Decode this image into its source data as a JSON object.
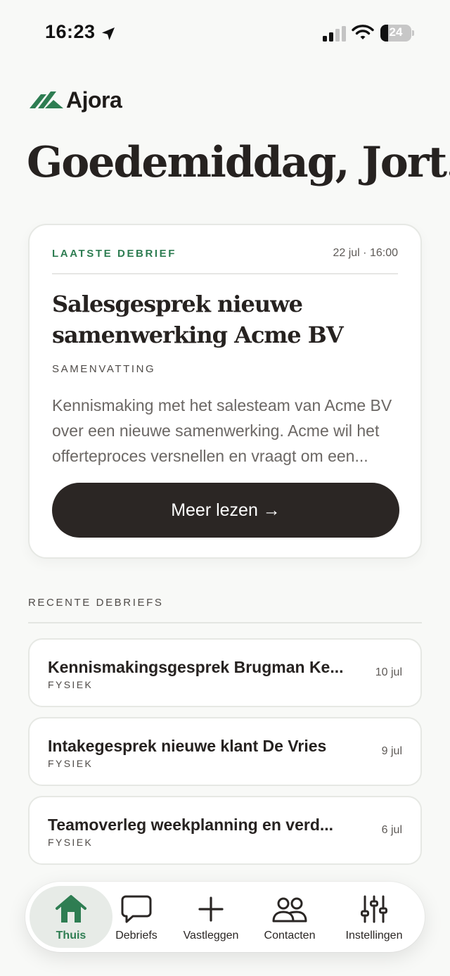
{
  "status_bar": {
    "time": "16:23",
    "battery": "24",
    "battery_level_percent": 24,
    "icons": [
      "location-arrow-icon",
      "signal-icon",
      "wifi-icon",
      "battery-icon"
    ]
  },
  "brand": {
    "name": "Ajora",
    "color": "#2e7d52"
  },
  "greeting": "Goedemiddag, Jort.",
  "latest": {
    "label": "LAATSTE DEBRIEF",
    "date": "22 jul · 16:00",
    "title": "Salesgesprek nieuwe samenwerking Acme BV",
    "summary_label": "SAMENVATTING",
    "summary": "Kennismaking met het salesteam van Acme BV over een nieuwe samenwerking. Acme wil het offerteproces versnellen en vraagt om een...",
    "button": "Meer lezen →"
  },
  "recent": {
    "header": "RECENTE DEBRIEFS",
    "items": [
      {
        "title": "Kennismakingsgesprek Brugman Ke...",
        "tag": "FYSIEK",
        "date": "10 jul"
      },
      {
        "title": "Intakegesprek nieuwe klant De Vries",
        "tag": "FYSIEK",
        "date": "9 jul"
      },
      {
        "title": "Teamoverleg weekplanning en verd...",
        "tag": "FYSIEK",
        "date": "6 jul"
      }
    ]
  },
  "nav": {
    "active": "Thuis",
    "items": [
      {
        "label": "Thuis",
        "icon": "home-icon"
      },
      {
        "label": "Debriefs",
        "icon": "chat-bubble-icon"
      },
      {
        "label": "Vastleggen",
        "icon": "plus-icon"
      },
      {
        "label": "Contacten",
        "icon": "people-icon"
      },
      {
        "label": "Instellingen",
        "icon": "sliders-icon"
      }
    ]
  },
  "colors": {
    "accent": "#2e7d52",
    "button": "#2b2624",
    "background": "#f8f9f7",
    "card": "#ffffff"
  }
}
